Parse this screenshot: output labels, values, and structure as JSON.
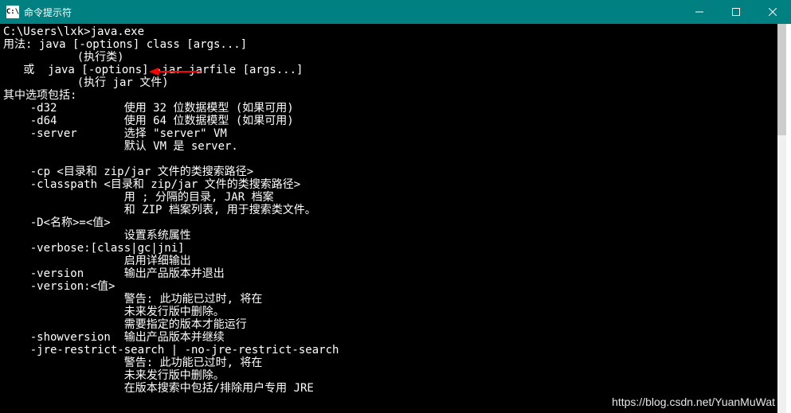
{
  "titlebar": {
    "icon_text": "C:\\",
    "title": "命令提示符"
  },
  "terminal": {
    "prompt": "C:\\Users\\lxk>",
    "command": "java.exe",
    "lines": [
      "用法: java [-options] class [args...]",
      "           (执行类)",
      "   或  java [-options] -jar jarfile [args...]",
      "           (执行 jar 文件)",
      "其中选项包括:",
      "    -d32          使用 32 位数据模型 (如果可用)",
      "    -d64          使用 64 位数据模型 (如果可用)",
      "    -server       选择 \"server\" VM",
      "                  默认 VM 是 server.",
      "",
      "    -cp <目录和 zip/jar 文件的类搜索路径>",
      "    -classpath <目录和 zip/jar 文件的类搜索路径>",
      "                  用 ; 分隔的目录, JAR 档案",
      "                  和 ZIP 档案列表, 用于搜索类文件。",
      "    -D<名称>=<值>",
      "                  设置系统属性",
      "    -verbose:[class|gc|jni]",
      "                  启用详细输出",
      "    -version      输出产品版本并退出",
      "    -version:<值>",
      "                  警告: 此功能已过时, 将在",
      "                  未来发行版中删除。",
      "                  需要指定的版本才能运行",
      "    -showversion  输出产品版本并继续",
      "    -jre-restrict-search | -no-jre-restrict-search",
      "                  警告: 此功能已过时, 将在",
      "                  未来发行版中删除。",
      "                  在版本搜索中包括/排除用户专用 JRE"
    ]
  },
  "watermark": "https://blog.csdn.net/YuanMuWat",
  "arrow_color": "#ff0000"
}
